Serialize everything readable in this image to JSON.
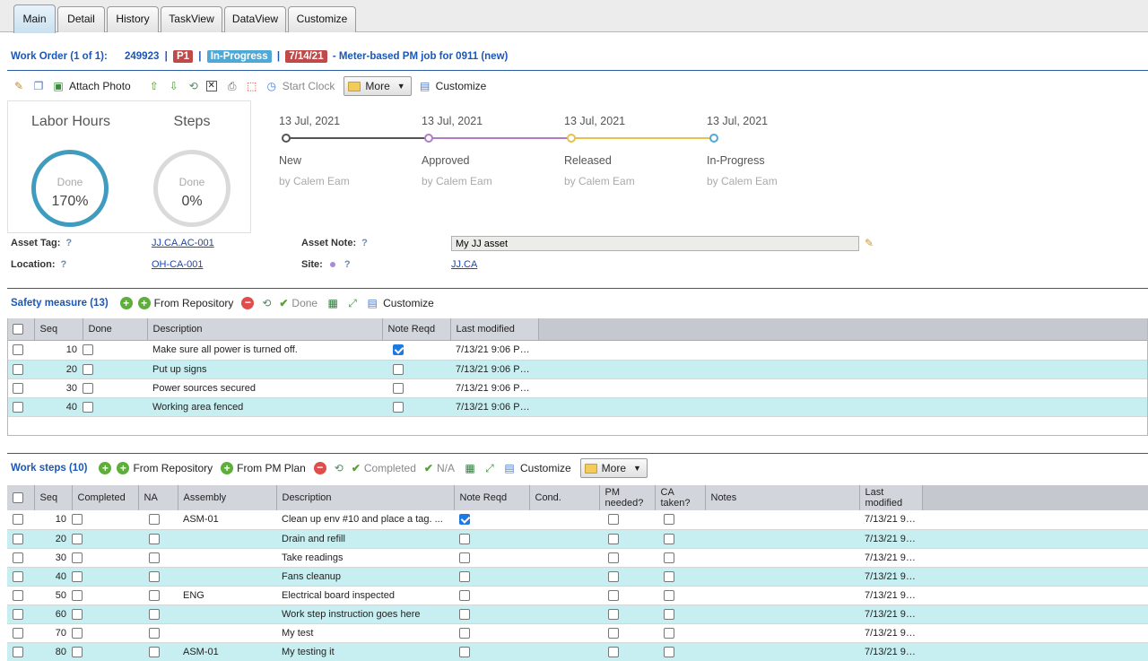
{
  "tabs": [
    {
      "label": "Main",
      "active": true
    },
    {
      "label": "Detail"
    },
    {
      "label": "History"
    },
    {
      "label": "TaskView"
    },
    {
      "label": "DataView"
    },
    {
      "label": "Customize"
    }
  ],
  "work_order": {
    "prefix": "Work Order (1 of 1):",
    "number": "249923",
    "priority": "P1",
    "status": "In-Progress",
    "date": "7/14/21",
    "description": "- Meter-based PM job for 0911 (new)"
  },
  "main_toolbar": {
    "attach_photo": "Attach Photo",
    "start_clock": "Start Clock",
    "more": "More",
    "customize": "Customize"
  },
  "dashboard": {
    "labor_title": "Labor Hours",
    "labor_done": "Done",
    "labor_value": "170%",
    "steps_title": "Steps",
    "steps_done": "Done",
    "steps_value": "0%",
    "stages": [
      {
        "date": "13 Jul, 2021",
        "name": "New",
        "by": "by Calem Eam",
        "color": "#555555"
      },
      {
        "date": "13 Jul, 2021",
        "name": "Approved",
        "by": "by Calem Eam",
        "color": "#b07cc8"
      },
      {
        "date": "13 Jul, 2021",
        "name": "Released",
        "by": "by Calem Eam",
        "color": "#e8c050"
      },
      {
        "date": "13 Jul, 2021",
        "name": "In-Progress",
        "by": "by Calem Eam",
        "color": "#4fa9d6"
      }
    ]
  },
  "asset": {
    "asset_tag_label": "Asset Tag:",
    "asset_tag": "JJ.CA.AC-001",
    "location_label": "Location:",
    "location": "OH-CA-001",
    "asset_note_label": "Asset Note:",
    "asset_note": "My JJ asset",
    "site_label": "Site:",
    "site": "JJ.CA",
    "help": "?"
  },
  "safety": {
    "title": "Safety measure (13)",
    "from_repository": "From Repository",
    "done": "Done",
    "customize": "Customize",
    "columns": [
      "Seq",
      "Done",
      "Description",
      "Note Reqd",
      "Last modified"
    ],
    "rows": [
      {
        "seq": "10",
        "done": false,
        "description": "Make sure all power is turned off.",
        "note": true,
        "modified": "7/13/21 9:06 PM..."
      },
      {
        "seq": "20",
        "done": false,
        "description": "Put up signs",
        "note": false,
        "modified": "7/13/21 9:06 PM..."
      },
      {
        "seq": "30",
        "done": false,
        "description": "Power sources secured",
        "note": false,
        "modified": "7/13/21 9:06 PM..."
      },
      {
        "seq": "40",
        "done": false,
        "description": "Working area fenced",
        "note": false,
        "modified": "7/13/21 9:06 PM..."
      }
    ]
  },
  "worksteps": {
    "title": "Work steps (10)",
    "from_repository": "From Repository",
    "from_pm_plan": "From PM Plan",
    "completed": "Completed",
    "na": "N/A",
    "customize": "Customize",
    "more": "More",
    "columns": [
      "Seq",
      "Completed",
      "NA",
      "Assembly",
      "Description",
      "Note Reqd",
      "Cond.",
      "PM needed?",
      "CA taken?",
      "Notes",
      "Last modified"
    ],
    "rows": [
      {
        "seq": "10",
        "assembly": "ASM-01",
        "description": "Clean up env #10 and place a tag. ...",
        "note": true,
        "modified": "7/13/21 9:..."
      },
      {
        "seq": "20",
        "assembly": "",
        "description": "Drain and refill",
        "note": false,
        "modified": "7/13/21 9:..."
      },
      {
        "seq": "30",
        "assembly": "",
        "description": "Take readings",
        "note": false,
        "modified": "7/13/21 9:..."
      },
      {
        "seq": "40",
        "assembly": "",
        "description": "Fans cleanup",
        "note": false,
        "modified": "7/13/21 9:..."
      },
      {
        "seq": "50",
        "assembly": "ENG",
        "description": "Electrical board inspected",
        "note": false,
        "modified": "7/13/21 9:..."
      },
      {
        "seq": "60",
        "assembly": "",
        "description": "Work step instruction goes here",
        "note": false,
        "modified": "7/13/21 9:..."
      },
      {
        "seq": "70",
        "assembly": "",
        "description": "My test",
        "note": false,
        "modified": "7/13/21 9:..."
      },
      {
        "seq": "80",
        "assembly": "ASM-01",
        "description": "My testing it",
        "note": false,
        "modified": "7/13/21 9:..."
      }
    ]
  }
}
